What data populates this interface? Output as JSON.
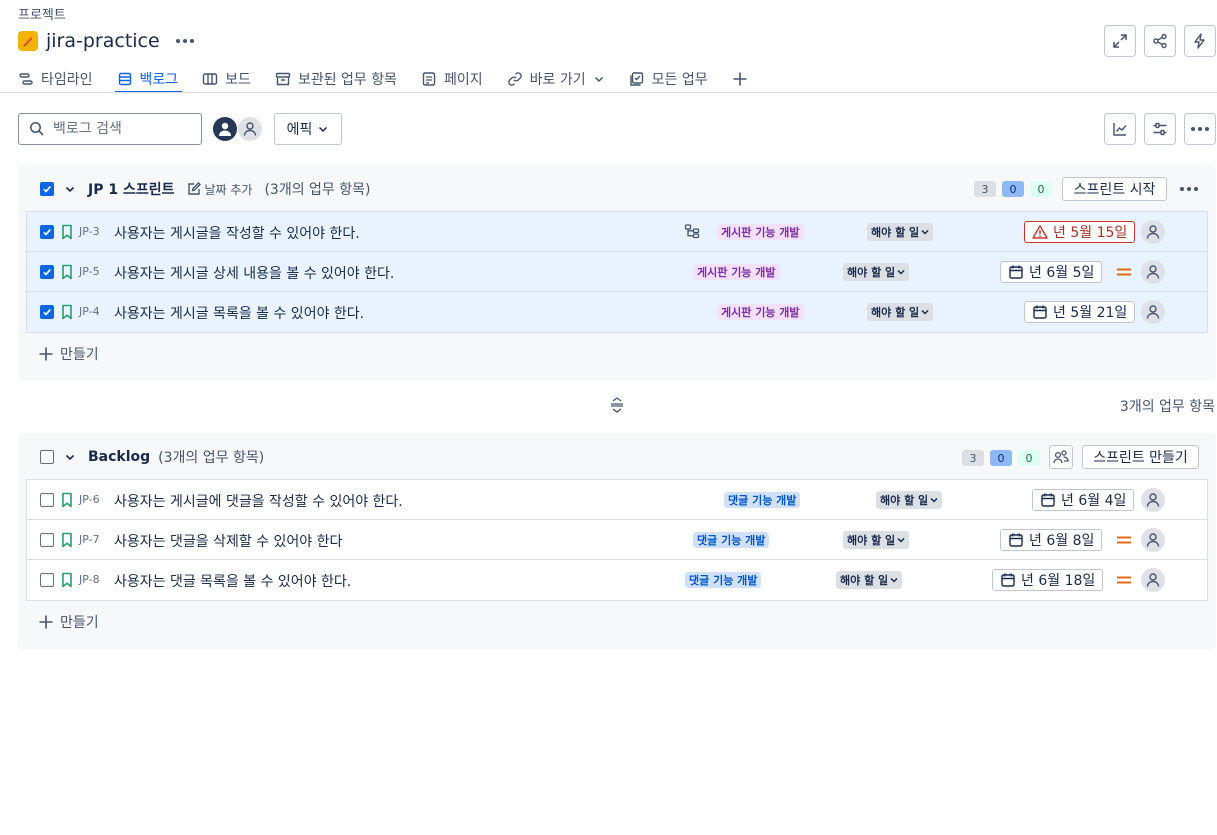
{
  "breadcrumb": "프로젝트",
  "project": {
    "name": "jira-practice"
  },
  "tabs": [
    {
      "label": "타임라인",
      "icon": "timeline-icon"
    },
    {
      "label": "백로그",
      "icon": "backlog-icon",
      "active": true
    },
    {
      "label": "보드",
      "icon": "board-icon"
    },
    {
      "label": "보관된 업무 항목",
      "icon": "archive-icon"
    },
    {
      "label": "페이지",
      "icon": "page-icon"
    },
    {
      "label": "바로 가기",
      "icon": "link-icon"
    },
    {
      "label": "모든 업무",
      "icon": "all-work-icon"
    }
  ],
  "search": {
    "placeholder": "백로그 검색",
    "value": ""
  },
  "epic_filter": "에픽",
  "sprint": {
    "name": "JP 1 스프린트",
    "date_add": "날짜 추가",
    "count": "(3개의 업무 항목)",
    "pills": [
      "3",
      "0",
      "0"
    ],
    "start_button": "스프린트 시작",
    "issues": [
      {
        "key": "JP-3",
        "summary": "사용자는 게시글을 작성할 수 있어야 한다.",
        "epic": "게시판 기능 개발",
        "status": "해야 할 일",
        "date": "년 5월 15일",
        "overdue": true,
        "priority": false
      },
      {
        "key": "JP-5",
        "summary": "사용자는 게시글 상세 내용을 볼 수 있어야 한다.",
        "epic": "게시판 기능 개발",
        "status": "해야 할 일",
        "date": "년 6월 5일",
        "overdue": false,
        "priority": true
      },
      {
        "key": "JP-4",
        "summary": "사용자는 게시글 목록을 볼 수 있어야 한다.",
        "epic": "게시판 기능 개발",
        "status": "해야 할 일",
        "date": "년 5월 21일",
        "overdue": false,
        "priority": false
      }
    ],
    "create_label": "만들기"
  },
  "total_label": "3개의 업무 항목",
  "backlog": {
    "name": "Backlog",
    "count": "(3개의 업무 항목)",
    "pills": [
      "3",
      "0",
      "0"
    ],
    "create_sprint_button": "스프린트 만들기",
    "issues": [
      {
        "key": "JP-6",
        "summary": "사용자는 게시글에 댓글을 작성할 수 있어야 한다.",
        "epic": "댓글 기능 개발",
        "status": "해야 할 일",
        "date": "년 6월 4일",
        "priority": false
      },
      {
        "key": "JP-7",
        "summary": "사용자는 댓글을 삭제할 수 있어야 한다",
        "epic": "댓글 기능 개발",
        "status": "해야 할 일",
        "date": "년 6월 8일",
        "priority": true
      },
      {
        "key": "JP-8",
        "summary": "사용자는 댓글 목록을 볼 수 있어야 한다.",
        "epic": "댓글 기능 개발",
        "status": "해야 할 일",
        "date": "년 6월 18일",
        "priority": true
      }
    ],
    "create_label": "만들기"
  },
  "colors": {
    "accent": "#0c66e4",
    "epic_purple": "#f3e0fc",
    "epic_blue": "#cfe1fd",
    "priority": "#e56910",
    "overdue": "#c9372c"
  }
}
